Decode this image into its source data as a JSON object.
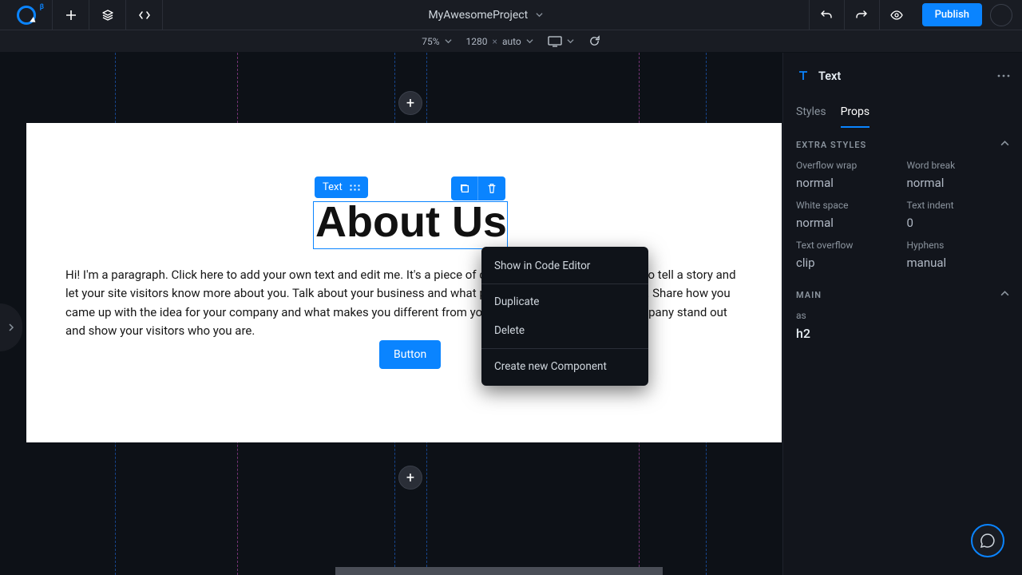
{
  "topbar": {
    "project_name": "MyAwesomeProject",
    "publish": "Publish",
    "beta_badge": "β"
  },
  "subbar": {
    "zoom": "75%",
    "width": "1280",
    "height_mode": "auto",
    "times": "×"
  },
  "selection": {
    "label": "Text"
  },
  "canvas": {
    "heading": "About Us",
    "paragraph": "Hi! I'm a paragraph. Click here to add your own text and edit me. It's a piece of cake. I'm a great space for you to tell a story and let your site visitors know more about you. Talk about your business and what products and services you offer. Share how you came up with the idea for your company and what makes you different from your competitors. Make your company stand out and show your visitors who you are.",
    "button_label": "Button"
  },
  "context_menu": {
    "show_in_code": "Show in Code Editor",
    "duplicate": "Duplicate",
    "delete": "Delete",
    "create_component": "Create new Component"
  },
  "panel": {
    "title": "Text",
    "tabs": {
      "styles": "Styles",
      "props": "Props"
    },
    "sections": {
      "extra_styles": {
        "title": "EXTRA STYLES",
        "fields": {
          "overflow_wrap_label": "Overflow wrap",
          "overflow_wrap_value": "normal",
          "word_break_label": "Word break",
          "word_break_value": "normal",
          "white_space_label": "White space",
          "white_space_value": "normal",
          "text_indent_label": "Text indent",
          "text_indent_value": "0",
          "text_overflow_label": "Text overflow",
          "text_overflow_value": "clip",
          "hyphens_label": "Hyphens",
          "hyphens_value": "manual"
        }
      },
      "main": {
        "title": "MAIN",
        "as_label": "as",
        "as_value": "h2"
      }
    }
  }
}
